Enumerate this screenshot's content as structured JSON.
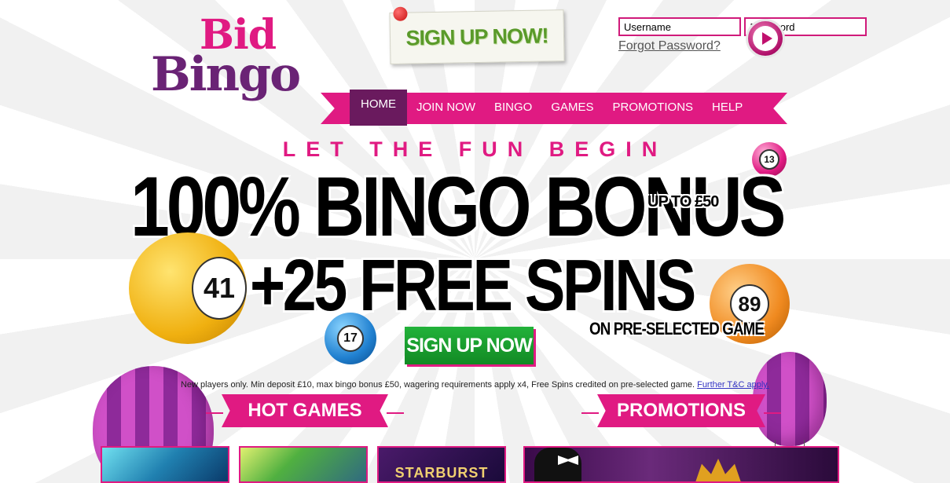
{
  "logo": {
    "line1": "Bid",
    "line2": "Bingo"
  },
  "header": {
    "signup_note": "SIGN UP NOW!"
  },
  "login": {
    "username_placeholder": "Username",
    "password_placeholder": "Password",
    "forgot": "Forgot Password?"
  },
  "nav": {
    "items": [
      {
        "label": "HOME",
        "active": true
      },
      {
        "label": "JOIN NOW"
      },
      {
        "label": "BINGO"
      },
      {
        "label": "GAMES"
      },
      {
        "label": "PROMOTIONS"
      },
      {
        "label": "HELP"
      }
    ]
  },
  "hero": {
    "tagline": "LET THE FUN BEGIN",
    "headline": "100% BINGO BONUS",
    "up_to": "UP TO £50",
    "free_spins": "+25 FREE SPINS",
    "pre_selected": "ON PRE-SELECTED GAME",
    "cta": "SIGN UP NOW",
    "balls": {
      "b41": "41",
      "b89": "89",
      "b17": "17",
      "b13": "13"
    }
  },
  "terms": {
    "text": "New players only. Min deposit £10, max bingo bonus £50, wagering requirements apply x4, Free Spins credited on pre-selected game. ",
    "link": "Further T&C apply."
  },
  "sections": {
    "hot_games": "HOT GAMES",
    "promotions": "PROMOTIONS"
  },
  "games": {
    "tile3_label": "STARBURST"
  },
  "colors": {
    "brand_pink": "#e01a82",
    "brand_purple": "#6a2375",
    "cta_green": "#1a9e30"
  }
}
